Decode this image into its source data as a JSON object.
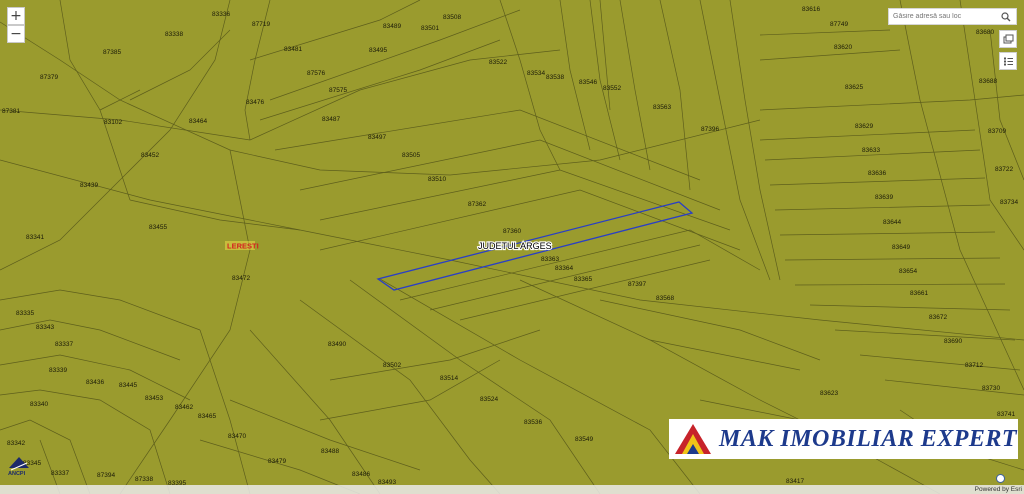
{
  "map": {
    "background_color": "#9a9b2e",
    "line_color": "#5e5f1c",
    "selected_parcel_color": "#2a3fc4",
    "place_label": "LERESTI",
    "county_label": "JUDETUL ARGES",
    "parcel_ids": [
      "83336",
      "87719",
      "83489",
      "83501",
      "83508",
      "83616",
      "87749",
      "83680",
      "83338",
      "83481",
      "83495",
      "87385",
      "83522",
      "83620",
      "87379",
      "87576",
      "83534",
      "83538",
      "83546",
      "83552",
      "87575",
      "83476",
      "83563",
      "83625",
      "83688",
      "87381",
      "83102",
      "83464",
      "83487",
      "87396",
      "83629",
      "83709",
      "83497",
      "83633",
      "83452",
      "83505",
      "83636",
      "83722",
      "83510",
      "83439",
      "83639",
      "83734",
      "87362",
      "83644",
      "83455",
      "87360",
      "83341",
      "83649",
      "83363",
      "83364",
      "83365",
      "83654",
      "83472",
      "87397",
      "83661",
      "83568",
      "83335",
      "83672",
      "83343",
      "83490",
      "83690",
      "83337",
      "83502",
      "83712",
      "83339",
      "83514",
      "83436",
      "83445",
      "83730",
      "83453",
      "83623",
      "83340",
      "83462",
      "83524",
      "83741",
      "83465",
      "83536",
      "83470",
      "83549",
      "83342",
      "83488",
      "83479",
      "83345",
      "83486",
      "83337",
      "87394",
      "87338",
      "83395",
      "83493",
      "83417"
    ]
  },
  "controls": {
    "zoom_in": "+",
    "zoom_out": "−",
    "search_placeholder": "Găsire adresă sau loc",
    "search_icon": "search-icon",
    "basemap_icon": "basemap-gallery-icon",
    "legend_icon": "legend-list-icon"
  },
  "branding": {
    "agency_logo_text": "ANCPI",
    "company_name": "MAK IMOBILIAR EXPERT",
    "powered_by": "Powered by Esri"
  }
}
